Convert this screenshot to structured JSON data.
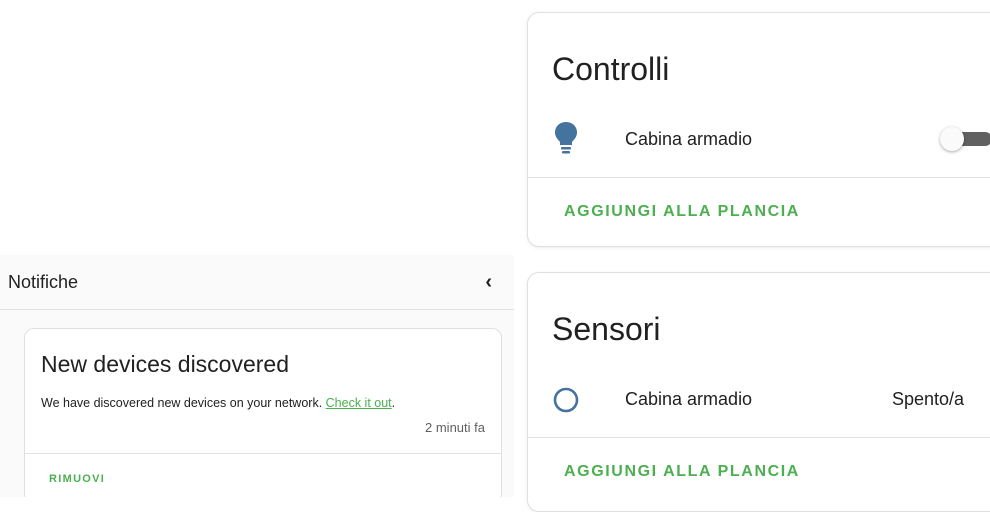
{
  "notifications": {
    "title": "Notifiche",
    "close_glyph": "‹",
    "card": {
      "title": "New devices discovered",
      "message_prefix": "We have discovered new devices on your network. ",
      "link_text": "Check it out",
      "message_suffix": ".",
      "time": "2 minuti fa",
      "action": "RIMUOVI"
    }
  },
  "controls_card": {
    "title": "Controlli",
    "entity": {
      "icon": "lightbulb-icon",
      "label": "Cabina armadio",
      "state": "off"
    },
    "action": "AGGIUNGI ALLA PLANCIA"
  },
  "sensors_card": {
    "title": "Sensori",
    "entity": {
      "icon": "circle-outline-icon",
      "label": "Cabina armadio",
      "state": "Spento/a"
    },
    "action": "AGGIUNGI ALLA PLANCIA"
  },
  "colors": {
    "accent": "#4caf50",
    "icon_blue": "#44739e",
    "toggle_track": "#616161"
  }
}
